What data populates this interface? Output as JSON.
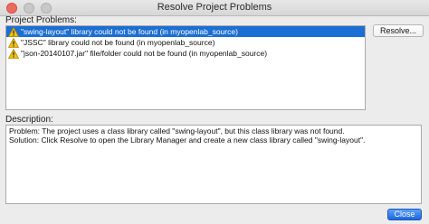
{
  "window": {
    "title": "Resolve Project Problems"
  },
  "problems": {
    "label": "Project Problems:",
    "items": [
      {
        "text": "\"swing-layout\" library could not be found (in myopenlab_source)",
        "icon": "warning-icon"
      },
      {
        "text": "\"JSSC\" library could not be found (in myopenlab_source)",
        "icon": "warning-icon"
      },
      {
        "text": "\"json-20140107.jar\" file/folder could not be found (in myopenlab_source)",
        "icon": "warning-icon"
      }
    ],
    "selected_index": 0
  },
  "buttons": {
    "resolve": "Resolve...",
    "close": "Close"
  },
  "description": {
    "label": "Description:",
    "lines": [
      "Problem: The project uses a class library called \"swing-layout\", but this class library was not found.",
      "Solution: Click Resolve to open the Library Manager and create a new class library called \"swing-layout\"."
    ]
  },
  "colors": {
    "selection": "#1b6ed3",
    "warning": "#f1c40f",
    "close_button": "#2a72e8"
  }
}
